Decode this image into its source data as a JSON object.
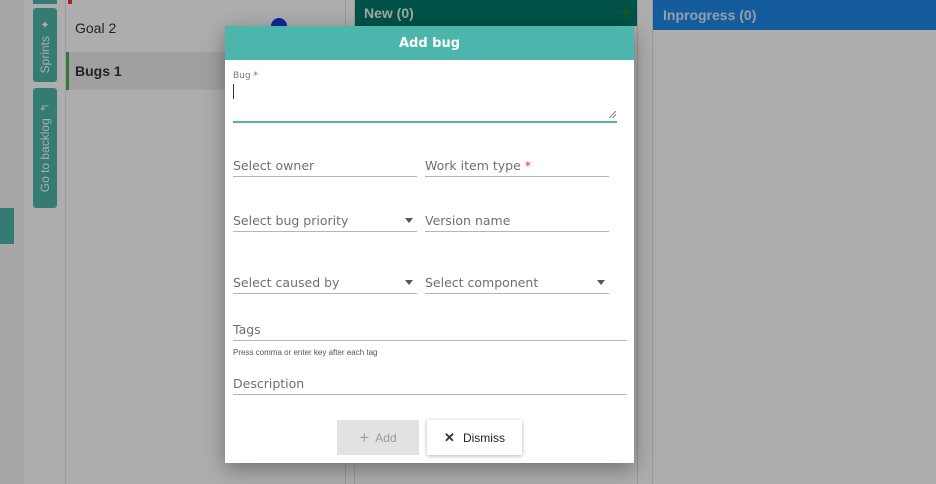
{
  "sidebar": {
    "sprints_label": "Sprints",
    "sprints_icon": "pin-icon",
    "backlog_label": "Go to backlog",
    "backlog_icon": "return-icon"
  },
  "list": {
    "items": [
      {
        "label": "Goal 2"
      },
      {
        "label": "Bugs 1"
      }
    ]
  },
  "board": {
    "columns": [
      {
        "label": "New (0)"
      },
      {
        "label": "Inprogress (0)"
      }
    ],
    "add_icon": "plus-icon"
  },
  "dialog": {
    "title": "Add bug",
    "bug_label": "Bug",
    "required_mark": "*",
    "owner_placeholder": "Select owner",
    "work_item_type_placeholder": "Work item type",
    "priority_placeholder": "Select bug priority",
    "version_placeholder": "Version name",
    "caused_by_placeholder": "Select caused by",
    "component_placeholder": "Select component",
    "tags_placeholder": "Tags",
    "tags_helper": "Press comma or enter key after each tag",
    "description_placeholder": "Description",
    "add_label": "Add",
    "dismiss_label": "Dismiss"
  },
  "colors": {
    "accent": "#4db6ac",
    "new_column": "#00796b",
    "inprogress_column": "#1e88e5",
    "required": "#e53935"
  }
}
